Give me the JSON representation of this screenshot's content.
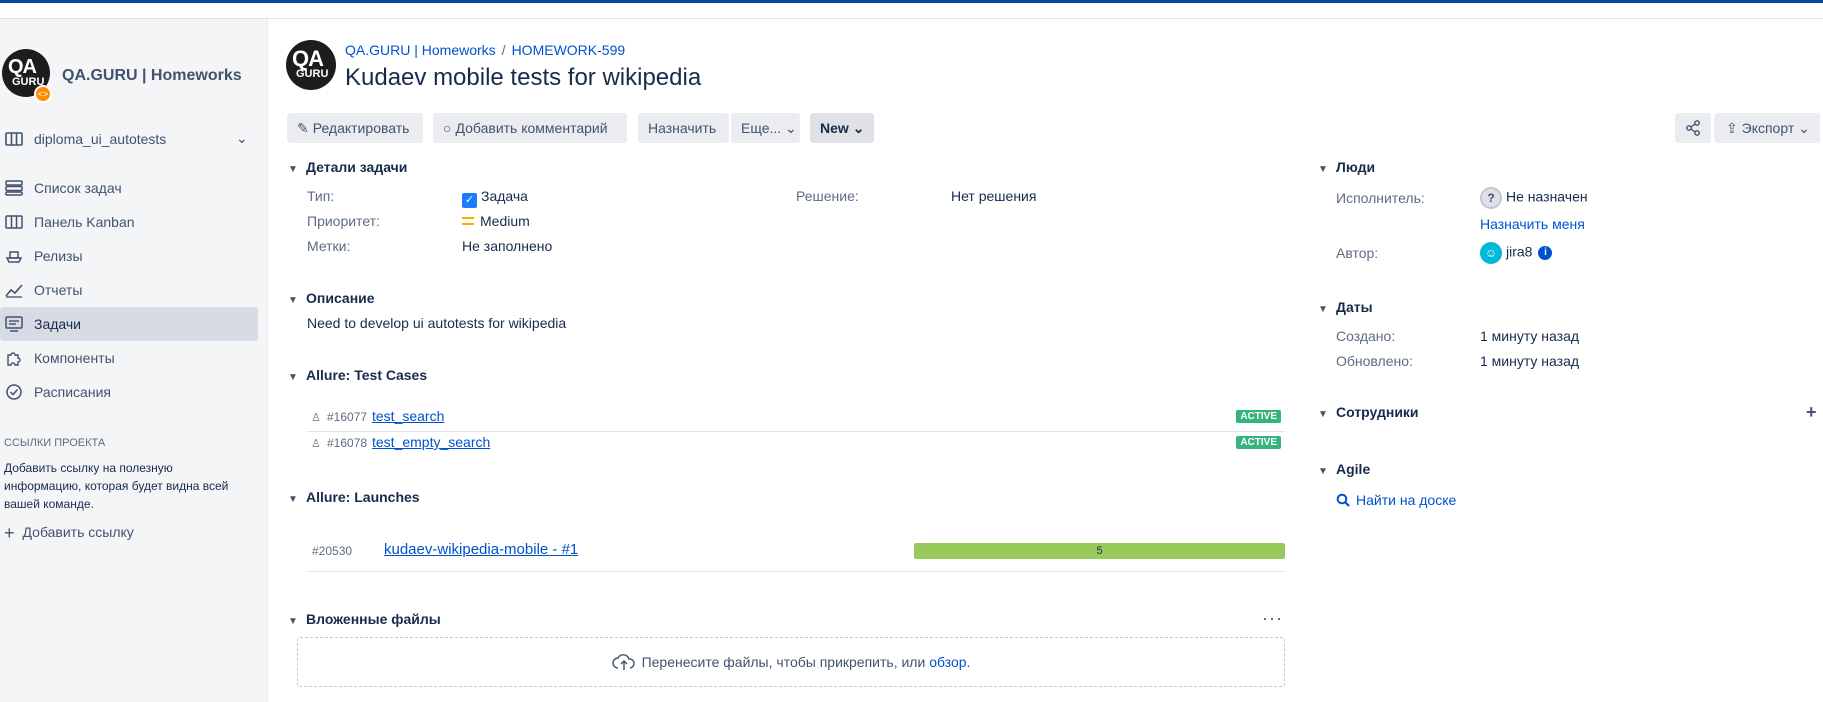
{
  "sidebar": {
    "project_name": "QA.GURU | Homeworks",
    "logo_text_top": "QA",
    "logo_text_bottom": "GURU",
    "logo_badge": "<>",
    "board": "diploma_ui_autotests",
    "items": [
      {
        "label": "Список задач",
        "icon": "list-icon"
      },
      {
        "label": "Панель Kanban",
        "icon": "kanban-icon"
      },
      {
        "label": "Релизы",
        "icon": "ship-icon"
      },
      {
        "label": "Отчеты",
        "icon": "chart-icon"
      },
      {
        "label": "Задачи",
        "icon": "issues-icon",
        "active": true
      },
      {
        "label": "Компоненты",
        "icon": "puzzle-icon"
      },
      {
        "label": "Расписания",
        "icon": "schedule-icon"
      }
    ],
    "project_links_title": "ССЫЛКИ ПРОЕКТА",
    "project_links_text": "Добавить ссылку на полезную информацию, которая будет видна всей вашей команде.",
    "add_link": "Добавить ссылку"
  },
  "header": {
    "breadcrumb_project": "QA.GURU | Homeworks",
    "breadcrumb_sep": "/",
    "breadcrumb_issue": "HOMEWORK-599",
    "title": "Kudaev mobile tests for wikipedia"
  },
  "toolbar": {
    "edit": "Редактировать",
    "comment": "Добавить комментарий",
    "assign": "Назначить",
    "more": "Еще...",
    "status": "New",
    "export": "Экспорт"
  },
  "details": {
    "title": "Детали задачи",
    "type_label": "Тип:",
    "type_value": "Задача",
    "priority_label": "Приоритет:",
    "priority_value": "Medium",
    "labels_label": "Метки:",
    "labels_value": "Не заполнено",
    "resolution_label": "Решение:",
    "resolution_value": "Нет решения"
  },
  "description": {
    "title": "Описание",
    "text": "Need to develop ui autotests for wikipedia"
  },
  "test_cases": {
    "title": "Allure: Test Cases",
    "rows": [
      {
        "id": "#16077",
        "name": "test_search",
        "status": "ACTIVE"
      },
      {
        "id": "#16078",
        "name": "test_empty_search",
        "status": "ACTIVE"
      }
    ]
  },
  "launches": {
    "title": "Allure: Launches",
    "rows": [
      {
        "id": "#20530",
        "name": "kudaev-wikipedia-mobile - #1",
        "passed": "5",
        "passed_fraction": 1.0
      }
    ]
  },
  "attachments": {
    "title": "Вложенные файлы",
    "menu": "···",
    "drop_text": "Перенесите файлы, чтобы прикрепить, или",
    "browse": "обзор."
  },
  "people": {
    "title": "Люди",
    "assignee_label": "Исполнитель:",
    "assignee_value": "Не назначен",
    "assign_me": "Назначить меня",
    "reporter_label": "Автор:",
    "reporter_value": "jira8"
  },
  "dates": {
    "title": "Даты",
    "created_label": "Создано:",
    "created_value": "1 минуту назад",
    "updated_label": "Обновлено:",
    "updated_value": "1 минуту назад"
  },
  "watchers": {
    "title": "Сотрудники"
  },
  "agile": {
    "title": "Agile",
    "find": "Найти на доске"
  },
  "colors": {
    "accent": "#0052cc",
    "top_bar": "#0747a6",
    "badge_active": "#36b37e",
    "launch_passed": "#97ca5b"
  }
}
